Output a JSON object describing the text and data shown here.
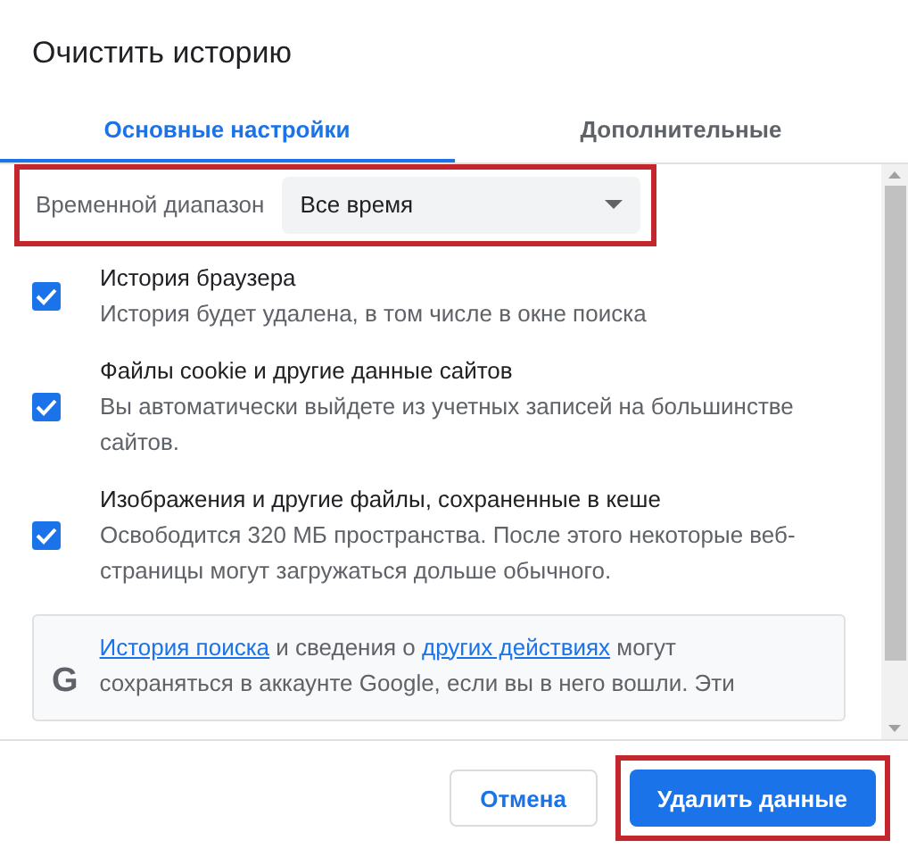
{
  "dialog": {
    "title": "Очистить историю"
  },
  "tabs": [
    {
      "label": "Основные настройки",
      "selected": true
    },
    {
      "label": "Дополнительные",
      "selected": false
    }
  ],
  "time_range": {
    "label": "Временной диапазон",
    "value": "Все время",
    "highlighted": true
  },
  "options": [
    {
      "title": "История браузера",
      "description": "История будет удалена, в том числе в окне поиска",
      "checked": true
    },
    {
      "title": "Файлы cookie и другие данные сайтов",
      "description": "Вы автоматически выйдете из учетных записей на большинстве сайтов.",
      "checked": true
    },
    {
      "title": "Изображения и другие файлы, сохраненные в кеше",
      "description": "Освободится 320 МБ пространства. После этого некоторые веб-страницы могут загружаться дольше обычного.",
      "checked": true
    }
  ],
  "google_note": {
    "icon": "G",
    "parts": [
      {
        "text": "История поиска",
        "link": true
      },
      {
        "text": " и сведения о ",
        "link": false
      },
      {
        "text": "других действиях",
        "link": true
      },
      {
        "text": " могут сохраняться в аккаунте Google, если вы в него вошли. Эти",
        "link": false
      }
    ]
  },
  "buttons": [
    {
      "label": "Отмена",
      "kind": "secondary",
      "highlighted": false
    },
    {
      "label": "Удалить данные",
      "kind": "primary",
      "highlighted": true
    }
  ]
}
